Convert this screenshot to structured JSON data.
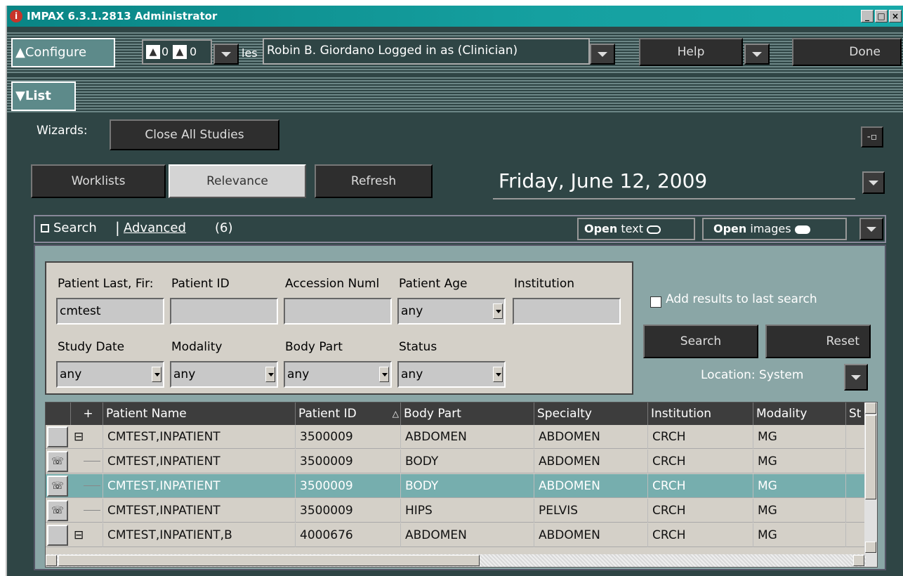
{
  "window": {
    "title": "IMPAX 6.3.1.2813 Administrator",
    "controls": [
      "_",
      "□",
      "×"
    ]
  },
  "configure_bar": {
    "configure_label": "▲Configure",
    "alert_counts": [
      "0",
      "0"
    ],
    "files_fragment": "les",
    "user_label": "Robin  B. Giordano Logged in as (Clinician)",
    "help_label": "Help",
    "done_label": "Done"
  },
  "list_bar": {
    "list_label": "▼List"
  },
  "wizards": {
    "label": "Wizards:",
    "close_all_label": "Close All Studies",
    "pin_label": "-▫"
  },
  "worklist_bar": {
    "worklists_label": "Worklists",
    "relevance_label": "Relevance",
    "refresh_label": "Refresh",
    "date": "Friday, June 12, 2009"
  },
  "search_header": {
    "search_label": "Search",
    "advanced_label": "Advanced",
    "count": "(6)",
    "open_text": "Open",
    "open_text_suffix": "text",
    "open_images": "Open",
    "open_images_suffix": "images"
  },
  "form": {
    "labels": {
      "patient_name": "Patient Last, Fir:",
      "patient_id": "Patient ID",
      "accession": "Accession Numl",
      "patient_age": "Patient Age",
      "institution": "Institution",
      "study_date": "Study Date",
      "modality": "Modality",
      "body_part": "Body Part",
      "status": "Status"
    },
    "values": {
      "patient_name": "cmtest",
      "patient_id": "",
      "accession": "",
      "patient_age": "any",
      "institution": "",
      "study_date": "any",
      "modality": "any",
      "body_part": "any",
      "status": "any"
    }
  },
  "search_actions": {
    "add_results_label": "Add results to last search",
    "add_results_checked": false,
    "search_label": "Search",
    "reset_label": "Reset",
    "location_label": "Location: System"
  },
  "grid": {
    "headers": [
      "+",
      "Patient Name",
      "Patient ID",
      "Body Part",
      "Specialty",
      "Institution",
      "Modality",
      "St"
    ],
    "sort_indicator": "△",
    "rows": [
      {
        "expander": "⊟",
        "patient_name": "CMTEST,INPATIENT",
        "patient_id": "3500009",
        "body_part": "ABDOMEN",
        "specialty": "ABDOMEN",
        "institution": "CRCH",
        "modality": "MG",
        "selected": false,
        "icon": ""
      },
      {
        "expander": "",
        "patient_name": "CMTEST,INPATIENT",
        "patient_id": "3500009",
        "body_part": "BODY",
        "specialty": "ABDOMEN",
        "institution": "CRCH",
        "modality": "MG",
        "selected": false,
        "icon": "phone-icon"
      },
      {
        "expander": "",
        "patient_name": "CMTEST,INPATIENT",
        "patient_id": "3500009",
        "body_part": "BODY",
        "specialty": "ABDOMEN",
        "institution": "CRCH",
        "modality": "MG",
        "selected": true,
        "icon": "phone-outline-icon"
      },
      {
        "expander": "",
        "patient_name": "CMTEST,INPATIENT",
        "patient_id": "3500009",
        "body_part": "HIPS",
        "specialty": "PELVIS",
        "institution": "CRCH",
        "modality": "MG",
        "selected": false,
        "icon": "phone-outline-icon"
      },
      {
        "expander": "⊟",
        "patient_name": "CMTEST,INPATIENT,B",
        "patient_id": "4000676",
        "body_part": "ABDOMEN",
        "specialty": "ABDOMEN",
        "institution": "CRCH",
        "modality": "MG",
        "selected": false,
        "icon": ""
      }
    ]
  },
  "colors": {
    "background": "#2f4545",
    "title_gradient": "#0a8585",
    "selected_row": "#76aeae",
    "form_bg": "#d4d0c8"
  }
}
